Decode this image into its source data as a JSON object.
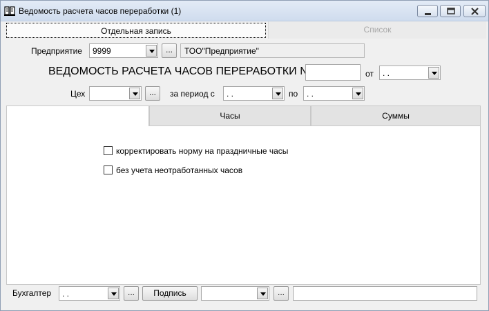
{
  "window": {
    "title": "Ведомость расчета часов переработки (1)",
    "app_icon": "book-icon"
  },
  "top_tabs": [
    {
      "label": "Отдельная запись",
      "active": true
    },
    {
      "label": "Список",
      "active": false
    }
  ],
  "enterprise": {
    "label": "Предприятие",
    "code": "9999",
    "name": "ТОО\"Предприятие\"",
    "browse": "..."
  },
  "heading": {
    "title": "ВЕДОМОСТЬ РАСЧЕТА ЧАСОВ ПЕРЕРАБОТКИ №",
    "number": "",
    "from_label": "от",
    "date": " .  ."
  },
  "department": {
    "label": "Цех",
    "value": "",
    "browse": "...",
    "period_label": "за период с",
    "period_from": " .  .",
    "to_label": "по",
    "period_to": " .  ."
  },
  "inner_tabs": [
    {
      "label": "",
      "active": true
    },
    {
      "label": "Часы",
      "active": false
    },
    {
      "label": "Суммы",
      "active": false
    }
  ],
  "options": [
    {
      "label": "корректировать норму на праздничные часы",
      "checked": false
    },
    {
      "label": "без учета неотработанных часов",
      "checked": false
    }
  ],
  "footer": {
    "accountant_label": "Бухгалтер",
    "accountant_date": " .  .",
    "browse1": "...",
    "sign_button": "Подпись",
    "sign_value": "",
    "browse2": "...",
    "note": ""
  }
}
